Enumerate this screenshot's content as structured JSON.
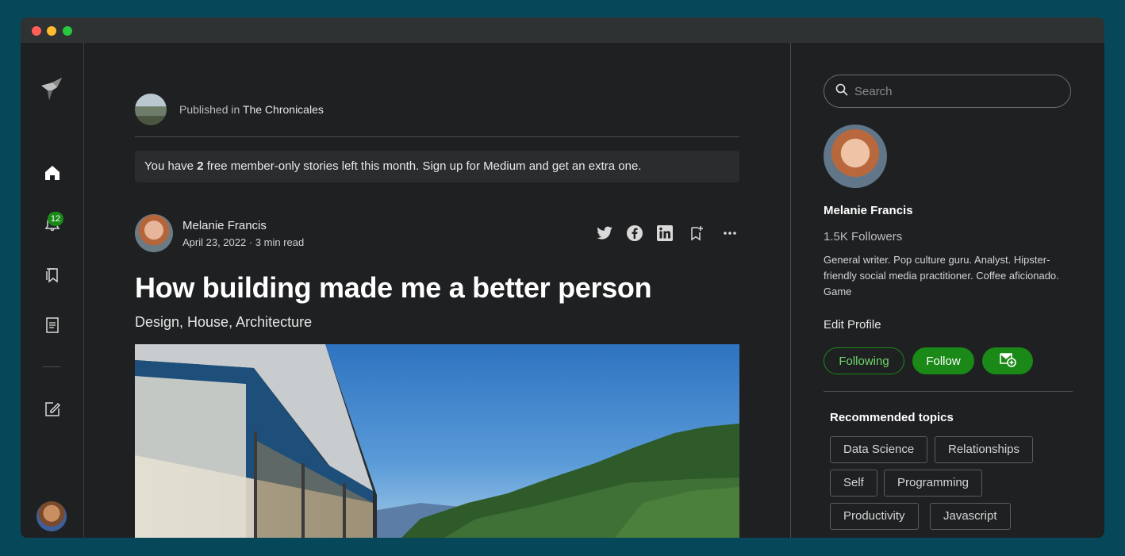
{
  "publication": {
    "prefix": "Published in ",
    "name": "The Chronicales"
  },
  "notice": {
    "before": "You have ",
    "count": "2",
    "after": " free member-only stories left this month. Sign up for Medium and get an extra one."
  },
  "nav": {
    "notifications_count": "12"
  },
  "article": {
    "author": "Melanie Francis",
    "meta": "April 23, 2022 · 3 min read",
    "title": "How building made me a better person",
    "tags": "Design, House, Architecture"
  },
  "sidebar": {
    "search_placeholder": "Search",
    "profile_name": "Melanie Francis",
    "followers": "1.5K Followers",
    "bio": "General writer. Pop culture guru. Analyst. Hipster-friendly social media practitioner. Coffee aficionado. Game",
    "edit_profile": "Edit Profile",
    "following_label": "Following",
    "follow_label": "Follow",
    "recommended_title": "Recommended topics",
    "topics": [
      "Data Science",
      "Relationships",
      "Self",
      "Programming",
      "Productivity",
      "Javascript"
    ]
  },
  "colors": {
    "accent": "#1a8917",
    "background": "#1f2022",
    "frame": "#06485a"
  },
  "icons": [
    "logo-icon",
    "home-icon",
    "bell-icon",
    "bookmarks-icon",
    "document-icon",
    "write-icon",
    "twitter-icon",
    "facebook-icon",
    "linkedin-icon",
    "bookmark-add-icon",
    "more-icon",
    "search-icon",
    "mail-subscribe-icon"
  ]
}
